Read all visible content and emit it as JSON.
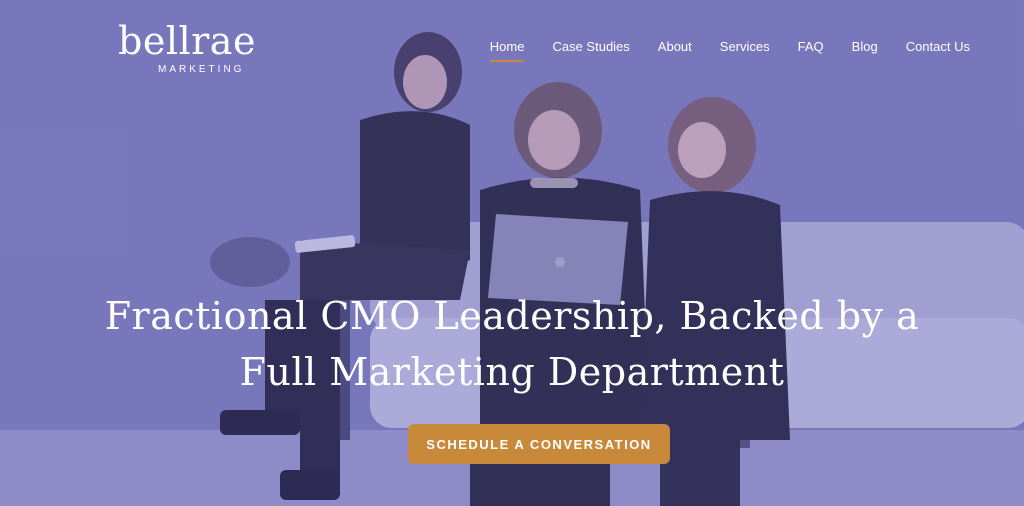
{
  "brand": {
    "name": "bellrae",
    "tagline": "MARKETING"
  },
  "nav": {
    "items": [
      {
        "label": "Home",
        "active": true
      },
      {
        "label": "Case Studies",
        "active": false
      },
      {
        "label": "About",
        "active": false
      },
      {
        "label": "Services",
        "active": false
      },
      {
        "label": "FAQ",
        "active": false
      },
      {
        "label": "Blog",
        "active": false
      },
      {
        "label": "Contact Us",
        "active": false
      }
    ]
  },
  "hero": {
    "headline_line1": "Fractional CMO Leadership, Backed by a",
    "headline_line2": "Full Marketing Department",
    "cta_label": "SCHEDULE A CONVERSATION"
  },
  "colors": {
    "overlay": "#7a79b8",
    "accent": "#c8893b",
    "text": "#ffffff"
  }
}
